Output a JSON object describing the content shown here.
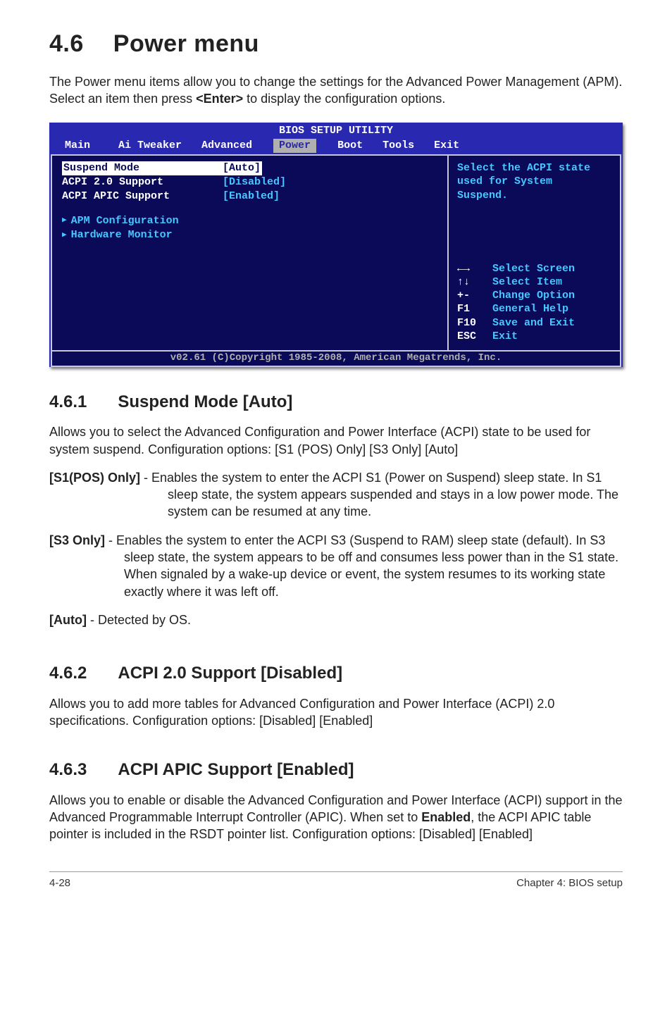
{
  "section": {
    "num": "4.6",
    "title": "Power menu"
  },
  "intro": "The Power menu items allow you to change the settings for the Advanced Power Management (APM). Select an item then press ",
  "intro_key": "<Enter>",
  "intro_tail": " to display the configuration options.",
  "bios": {
    "title": "BIOS SETUP UTILITY",
    "menu": [
      "Main",
      "Ai Tweaker",
      "Advanced",
      "Power",
      "Boot",
      "Tools",
      "Exit"
    ],
    "active_menu": "Power",
    "items": [
      {
        "label": "Suspend Mode",
        "value": "[Auto]",
        "highlight": true
      },
      {
        "label": "ACPI 2.0 Support",
        "value": "[Disabled]",
        "highlight": false
      },
      {
        "label": "ACPI APIC Support",
        "value": "[Enabled]",
        "highlight": false
      }
    ],
    "subitems": [
      "APM Configuration",
      "Hardware Monitor"
    ],
    "help_top": [
      "Select the ACPI state",
      "used for System",
      "Suspend."
    ],
    "help_keys": [
      {
        "k": "←→",
        "d": "Select Screen"
      },
      {
        "k": "↑↓",
        "d": "Select Item"
      },
      {
        "k": "+-",
        "d": "Change Option"
      },
      {
        "k": "F1",
        "d": "General Help"
      },
      {
        "k": "F10",
        "d": "Save and Exit"
      },
      {
        "k": "ESC",
        "d": "Exit"
      }
    ],
    "footer": "v02.61 (C)Copyright 1985-2008, American Megatrends, Inc."
  },
  "sub461": {
    "num": "4.6.1",
    "title": "Suspend Mode [Auto]",
    "p": "Allows you to select the Advanced Configuration and Power Interface (ACPI) state to be used for system suspend. Configuration options: [S1 (POS) Only] [S3 Only] [Auto]",
    "opt1_label": "[S1(POS) Only]",
    "opt1_text": " - Enables the system to enter the ACPI S1 (Power on Suspend) sleep state. In S1 sleep state, the system appears suspended and stays in a low power mode. The system can be resumed at any time.",
    "opt2_label": "[S3 Only]",
    "opt2_text": " - Enables the system to enter the ACPI S3 (Suspend to RAM) sleep state (default). In S3 sleep state, the system appears to be off and consumes less power than in the S1 state. When signaled by a wake-up device or event, the system resumes to its working state exactly where it was left off.",
    "opt3_label": "[Auto]",
    "opt3_text": " - Detected by OS."
  },
  "sub462": {
    "num": "4.6.2",
    "title": "ACPI 2.0 Support [Disabled]",
    "p": "Allows you to add more tables for Advanced Configuration and Power Interface (ACPI) 2.0 specifications. Configuration options: [Disabled] [Enabled]"
  },
  "sub463": {
    "num": "4.6.3",
    "title": "ACPI APIC Support [Enabled]",
    "p1": "Allows you to enable or disable the Advanced Configuration and Power Interface (ACPI) support in the Advanced Programmable Interrupt Controller (APIC). When set to ",
    "p1_bold": "Enabled",
    "p1_tail": ", the ACPI APIC table pointer is included in the RSDT pointer list. Configuration options: [Disabled] [Enabled]"
  },
  "footer": {
    "left": "4-28",
    "right": "Chapter 4: BIOS setup"
  }
}
